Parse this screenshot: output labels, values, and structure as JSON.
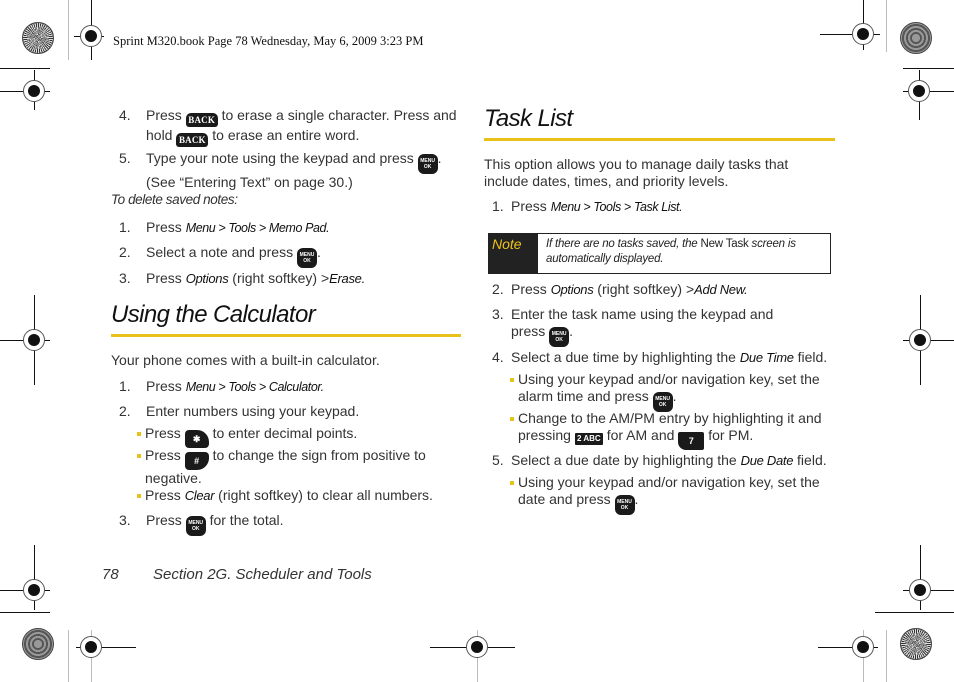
{
  "print_header": "Sprint M320.book  Page 78  Wednesday, May 6, 2009  3:23 PM",
  "left_column": {
    "steps_top": [
      {
        "num": "4.",
        "line1_pre": "Press",
        "key1": "BACK",
        "line1_post": "to erase a single character. Press and",
        "line2_pre": "hold",
        "key2": "BACK",
        "line2_post": "to erase an entire word."
      },
      {
        "num": "5.",
        "line1_pre": "Type your note using the keypad and press",
        "key1": "MENU OK",
        "line1_post": ".",
        "line2": "(See “Entering Text” on page 30.)"
      }
    ],
    "subhead": "To delete saved notes:",
    "delete_steps": [
      {
        "num": "1.",
        "pre": "Press",
        "path": "Menu > Tools > Memo Pad."
      },
      {
        "num": "2.",
        "pre": "Select a note and press",
        "key": "MENU OK",
        "post": "."
      },
      {
        "num": "3.",
        "pre": "Press",
        "options": "Options",
        "mid": "(right softkey) >",
        "action": "Erase."
      }
    ],
    "section_title": "Using the Calculator",
    "intro": "Your phone comes with a built-in calculator.",
    "calc_steps": [
      {
        "num": "1.",
        "pre": "Press",
        "path": "Menu > Tools > Calculator."
      },
      {
        "num": "2.",
        "text": "Enter numbers using your keypad."
      },
      {
        "num": "3.",
        "pre": "Press",
        "key": "MENU OK",
        "post": "for the total."
      }
    ],
    "calc_bullets": [
      {
        "pre": "Press",
        "key": "✱ Shift",
        "post": "to enter decimal points."
      },
      {
        "pre": "Press",
        "key": "# Space",
        "post": "to change the sign from positive to",
        "line2": "negative."
      },
      {
        "pre": "Press",
        "ital": "Clear",
        "post": "(right softkey) to clear all numbers."
      }
    ]
  },
  "right_column": {
    "section_title": "Task List",
    "intro_line1": "This option allows you to manage daily tasks that",
    "intro_line2": "include dates, times, and priority levels.",
    "step1": {
      "num": "1.",
      "pre": "Press",
      "path": "Menu > Tools > Task List."
    },
    "note": {
      "label": "Note",
      "pre": "If there are no tasks saved, the",
      "emph": "New Task",
      "post": "screen is",
      "line2": "automatically displayed."
    },
    "steps": [
      {
        "num": "2.",
        "pre": "Press",
        "options": "Options",
        "mid": "(right softkey) >",
        "action": "Add New."
      },
      {
        "num": "3.",
        "line1": "Enter the task name using the keypad and",
        "line2_pre": "press",
        "key": "MENU OK",
        "line2_post": "."
      },
      {
        "num": "4.",
        "pre": "Select a due time by highlighting the",
        "field": "Due Time",
        "post": "field."
      },
      {
        "num": "5.",
        "pre": "Select a due date by highlighting the",
        "field": "Due Date",
        "post": "field."
      }
    ],
    "time_bullets": [
      {
        "line1": "Using your keypad and/or navigation key, set the",
        "line2_pre": "alarm time and press",
        "key": "MENU OK",
        "line2_post": "."
      },
      {
        "line1": "Change to the AM/PM entry by highlighting it and",
        "line2_pre": "pressing",
        "key_am": "2 ABC",
        "mid": "for AM and",
        "key_pm": "7 PQRS",
        "line2_post": "for PM."
      }
    ],
    "date_bullets": [
      {
        "line1": "Using your keypad and/or navigation key, set the",
        "line2_pre": "date and press",
        "key": "MENU OK",
        "line2_post": "."
      }
    ]
  },
  "footer": {
    "page_number": "78",
    "section": "Section 2G. Scheduler and Tools"
  },
  "colors": {
    "accent_rule": "#e8c21a",
    "note_label": "#f0c419",
    "key_bg": "#1a1a1a"
  }
}
